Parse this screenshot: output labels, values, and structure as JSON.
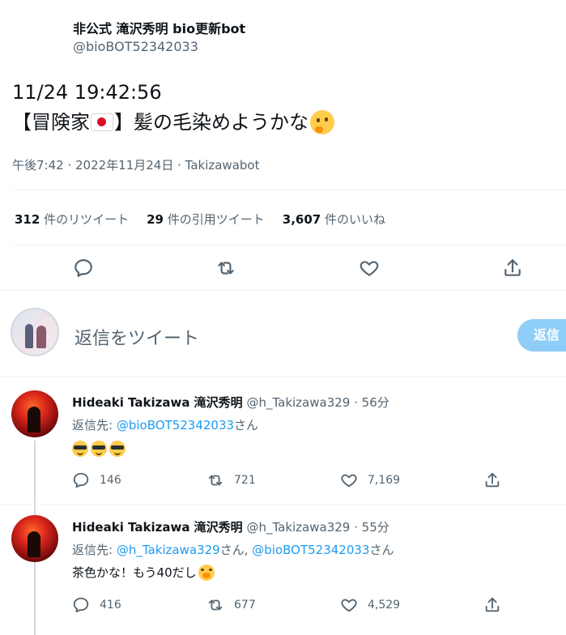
{
  "tweet": {
    "author_name": "非公式 滝沢秀明 bio更新bot",
    "author_handle": "@bioBOT52342033",
    "text_line1": "11/24 19:42:56",
    "text_open": "【冒険家",
    "text_close": "】髪の毛染めようかな",
    "meta": "午後7:42 · 2022年11月24日 · Takizawabot",
    "retweets_count": "312",
    "retweets_label": "件のリツイート",
    "quotes_count": "29",
    "quotes_label": "件の引用ツイート",
    "likes_count": "3,607",
    "likes_label": "件のいいね"
  },
  "composer": {
    "placeholder": "返信をツイート",
    "button": "返信"
  },
  "replies": [
    {
      "name": "Hideaki Takizawa 滝沢秀明",
      "handle": "@h_Takizawa329",
      "time": "· 56分",
      "reply_to_prefix": "返信先: ",
      "reply_to_link1": "@bioBOT52342033",
      "reply_to_suffix1": "さん",
      "replies": "146",
      "retweets": "721",
      "likes": "7,169"
    },
    {
      "name": "Hideaki Takizawa 滝沢秀明",
      "handle": "@h_Takizawa329",
      "time": "· 55分",
      "reply_to_prefix": "返信先: ",
      "reply_to_link1": "@h_Takizawa329",
      "reply_to_mid": "さん, ",
      "reply_to_link2": "@bioBOT52342033",
      "reply_to_suffix2": "さん",
      "body": "茶色かな！もう40だし",
      "replies": "416",
      "retweets": "677",
      "likes": "4,529"
    }
  ],
  "colors": {
    "accent": "#1d9bf0",
    "muted": "#536471",
    "reply_button": "#8ecdf8"
  }
}
